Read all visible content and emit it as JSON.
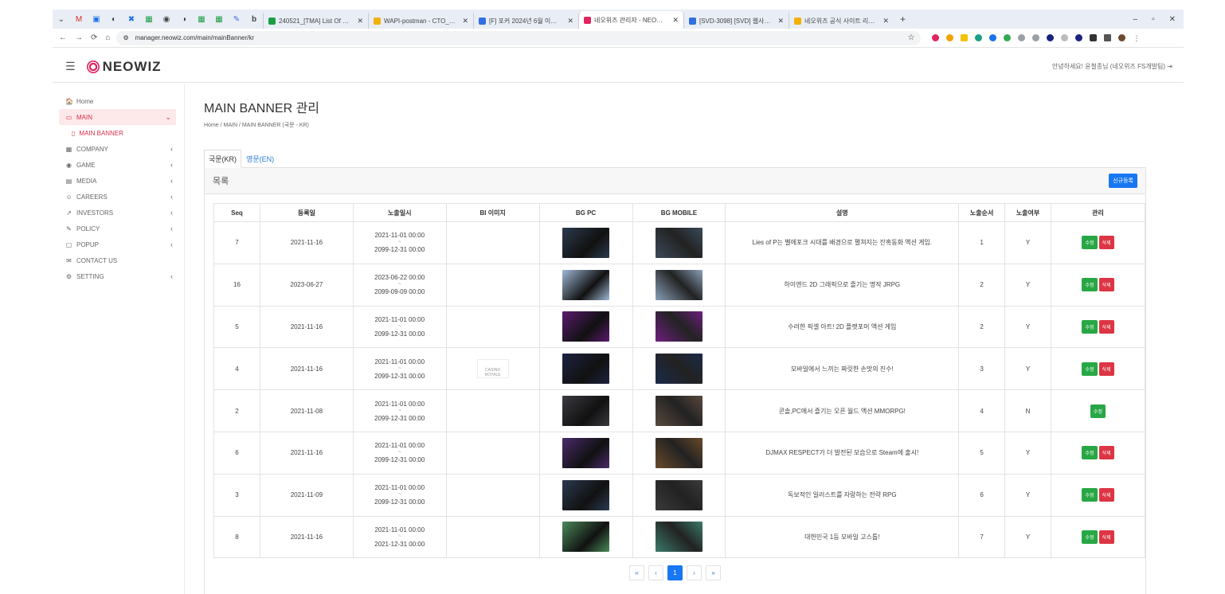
{
  "browser": {
    "tabs": [
      {
        "label": "240521_[TMA] List Of Clarific",
        "color": "#1a9e44"
      },
      {
        "label": "WAPI-postman - CTO_서비스",
        "color": "#f2b100"
      },
      {
        "label": "[F] 포커 2024년 6월 이슈 정",
        "color": "#2f6fde"
      },
      {
        "label": "네오위즈 관리자 - NEOWIZ M",
        "color": "#e0245e",
        "active": true
      },
      {
        "label": "[SVD-3098] [SVD] 웹사이트 기",
        "color": "#2f6fde"
      },
      {
        "label": "네오위즈 공식 사이트 리뉴얼",
        "color": "#f2b100"
      }
    ],
    "url": "manager.neowiz.com/main/mainBanner/kr",
    "nav": {
      "back": "←",
      "forward": "→",
      "reload": "⟳",
      "home": "⌂"
    },
    "window": {
      "min": "–",
      "max": "▫",
      "close": "✕"
    }
  },
  "header": {
    "logo": "NEOWIZ",
    "greeting": "안녕하세요! 윤철종님 (네오위즈 FS개발팀)"
  },
  "sidebar": {
    "items": [
      {
        "label": "Home",
        "icon": "🏠"
      },
      {
        "label": "MAIN",
        "icon": "▭",
        "active": true
      },
      {
        "label": "COMPANY",
        "icon": "▦",
        "chev": "‹"
      },
      {
        "label": "GAME",
        "icon": "◉",
        "chev": "‹"
      },
      {
        "label": "MEDIA",
        "icon": "▤",
        "chev": "‹"
      },
      {
        "label": "CAREERS",
        "icon": "☺",
        "chev": "‹"
      },
      {
        "label": "INVESTORS",
        "icon": "↗",
        "chev": "‹"
      },
      {
        "label": "POLICY",
        "icon": "✎",
        "chev": "‹"
      },
      {
        "label": "POPUP",
        "icon": "▢",
        "chev": "‹"
      },
      {
        "label": "CONTACT US",
        "icon": "✉"
      },
      {
        "label": "SETTING",
        "icon": "⚙",
        "chev": "‹"
      }
    ],
    "sub_item": "MAIN BANNER",
    "active_chev": "⌄"
  },
  "page": {
    "title": "MAIN BANNER 관리",
    "breadcrumb": "Home  /  MAIN  /  MAIN BANNER (국문 - KR)",
    "tab_kr": "국문(KR)",
    "tab_en": "영문(EN)",
    "panel_title": "목록",
    "new_button": "신규등록"
  },
  "table": {
    "headers": [
      "Seq",
      "등록일",
      "노출일시",
      "BI 이미지",
      "BG PC",
      "BG MOBILE",
      "설명",
      "노출순서",
      "노출여부",
      "관리"
    ],
    "edit_label": "수정",
    "delete_label": "삭제",
    "rows": [
      {
        "seq": "7",
        "reg": "2021-11-16",
        "start": "2021-11-01 00:00",
        "end": "2099-12-31 00:00",
        "bi": "",
        "desc": "Lies of P는 벨에포크 시대를 배경으로 펼쳐지는 잔혹동화 액션 게임.",
        "order": "1",
        "show": "Y",
        "pc": "#2b3b4e",
        "mo": "#3a4a5a"
      },
      {
        "seq": "16",
        "reg": "2023-06-27",
        "start": "2023-06-22 00:00",
        "end": "2099-09-09 00:00",
        "bi": "",
        "desc": "하이엔드 2D 그래픽으로 즐기는 명작 JRPG",
        "order": "2",
        "show": "Y",
        "pc": "#9fb8d6",
        "mo": "#8aa0b8"
      },
      {
        "seq": "5",
        "reg": "2021-11-16",
        "start": "2021-11-01 00:00",
        "end": "2099-12-31 00:00",
        "bi": "",
        "desc": "수려한 픽셀 아트! 2D 플랫포머 액션 게임",
        "order": "2",
        "show": "Y",
        "pc": "#5a1a6e",
        "mo": "#6e1f7e"
      },
      {
        "seq": "4",
        "reg": "2021-11-16",
        "start": "2021-11-01 00:00",
        "end": "2099-12-31 00:00",
        "bi": "CASINO ROYALE",
        "desc": "모바일에서 느끼는 짜릿한 손맛의 진수!",
        "order": "3",
        "show": "Y",
        "pc": "#1c2340",
        "mo": "#1a2a4a"
      },
      {
        "seq": "2",
        "reg": "2021-11-08",
        "start": "2021-11-01 00:00",
        "end": "2099-12-31 00:00",
        "bi": "",
        "desc": "콘솔,PC에서 즐기는 오픈 월드 액션 MMORPG!",
        "order": "4",
        "show": "N",
        "pc": "#3a3a40",
        "mo": "#5a4a3e"
      },
      {
        "seq": "6",
        "reg": "2021-11-16",
        "start": "2021-11-01 00:00",
        "end": "2099-12-31 00:00",
        "bi": "",
        "desc": "DJMAX RESPECT가 더 발전된 모습으로 Steam에 출시!",
        "order": "5",
        "show": "Y",
        "pc": "#4a2a6a",
        "mo": "#6a4a2a"
      },
      {
        "seq": "3",
        "reg": "2021-11-09",
        "start": "2021-11-01 00:00",
        "end": "2099-12-31 00:00",
        "bi": "",
        "desc": "독보적인 일러스트를 자랑하는 전략 RPG",
        "order": "6",
        "show": "Y",
        "pc": "#2a3a50",
        "mo": "#3a3a3a"
      },
      {
        "seq": "8",
        "reg": "2021-11-16",
        "start": "2021-11-01 00:00",
        "end": "2021-12-31 00:00",
        "bi": "",
        "desc": "대한민국 1등 모바일 고스톱!",
        "order": "7",
        "show": "Y",
        "pc": "#4a8a5a",
        "mo": "#3a7a6a"
      }
    ]
  },
  "pager": {
    "first": "«",
    "prev": "‹",
    "current": "1",
    "next": "›",
    "last": "»"
  }
}
